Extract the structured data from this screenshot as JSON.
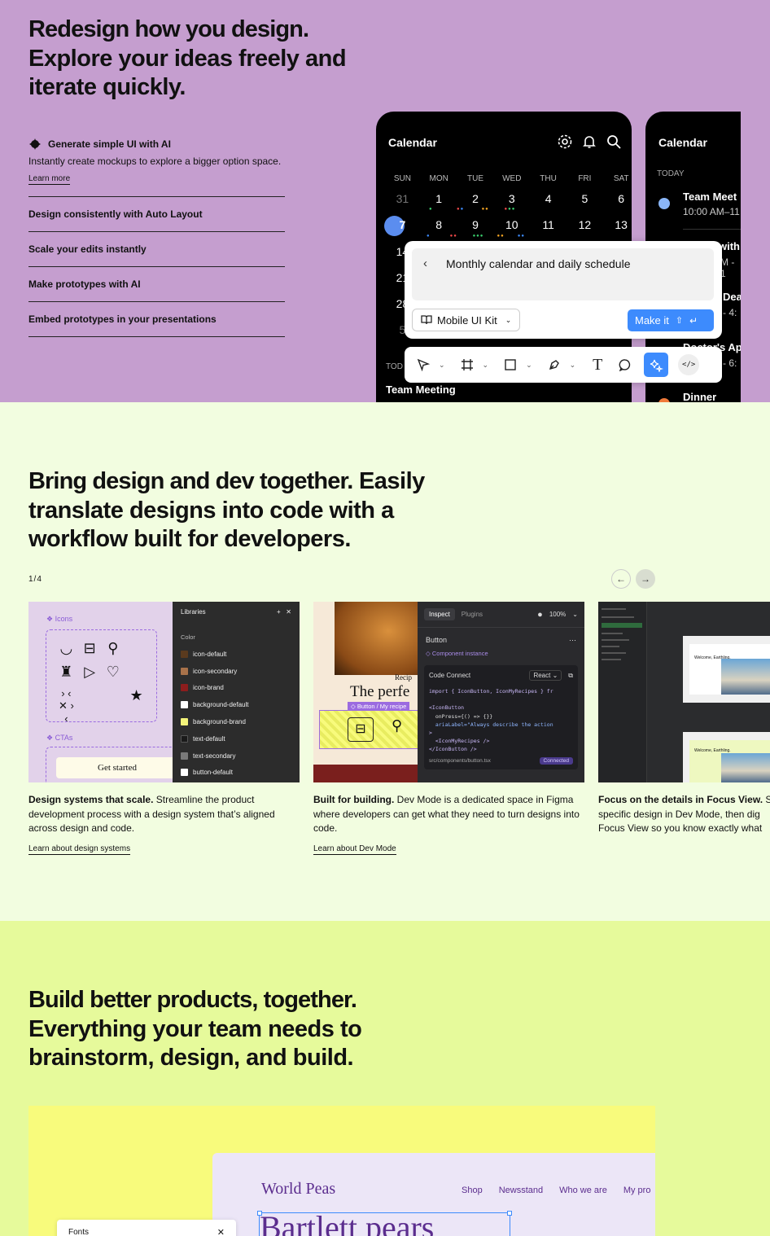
{
  "hero": {
    "title_bold": "Redesign how you design.",
    "title_rest": "Explore your ideas freely and iterate quickly.",
    "features": [
      {
        "title": "Generate simple UI with AI",
        "desc": "Instantly create mockups to explore a bigger option space.",
        "link": "Learn more",
        "active": true
      },
      {
        "title": "Design consistently with Auto Layout"
      },
      {
        "title": "Scale your edits instantly"
      },
      {
        "title": "Make prototypes with AI"
      },
      {
        "title": "Embed prototypes in your presentations"
      }
    ],
    "phone1": {
      "title": "Calendar",
      "weekdays": [
        "SUN",
        "MON",
        "TUE",
        "WED",
        "THU",
        "FRI",
        "SAT"
      ],
      "rows": [
        [
          "31",
          "1",
          "2",
          "3",
          "4",
          "5",
          "6"
        ],
        [
          "7",
          "8",
          "9",
          "10",
          "11",
          "12",
          "13"
        ],
        [
          "14"
        ],
        [
          "21"
        ],
        [
          "28"
        ],
        [
          "5"
        ]
      ],
      "today_label": "TOD",
      "event": "Team Meeting"
    },
    "phone2": {
      "title": "Calendar",
      "today_label": "TODAY",
      "events": [
        {
          "name": "Team Meet",
          "time": "10:00 AM–11"
        },
        {
          "name": "with",
          "time": "M - 1"
        },
        {
          "name": "Dea",
          "time": "- 4:"
        },
        {
          "name": "Doctor's Ap",
          "time": "- 6:"
        },
        {
          "name": "Dinner",
          "time": ""
        }
      ]
    },
    "prompt": {
      "text": "Monthly calendar and daily schedule",
      "kit": "Mobile UI Kit",
      "make": "Make it"
    }
  },
  "dev": {
    "title_bold": "Bring design and dev together.",
    "title_rest": "Easily translate designs into code with a workflow built for developers.",
    "pager": "1/4",
    "cards": [
      {
        "bold": "Design systems that scale.",
        "text": " Streamline the product development process with a design system that’s aligned across design and code.",
        "link": "Learn about design systems"
      },
      {
        "bold": "Built for building.",
        "text": " Dev Mode is a dedicated space in Figma where developers can get what they need to turn designs into code.",
        "link": "Learn about Dev Mode"
      },
      {
        "bold": "Focus on the details in Focus View.",
        "text": " Se specific design in Dev Mode, then dig Focus View so you know exactly what",
        "link": ""
      }
    ],
    "card1": {
      "icons_label": "Icons",
      "ctas_label": "CTAs",
      "cta_button": "Get started",
      "libraries_title": "Libraries",
      "color_label": "Color",
      "colors": [
        {
          "name": "icon-default",
          "color": "#5a3a1e"
        },
        {
          "name": "icon-secondary",
          "color": "#a8724a"
        },
        {
          "name": "icon-brand",
          "color": "#8c1d1d"
        },
        {
          "name": "background-default",
          "color": "#ffffff"
        },
        {
          "name": "background-brand",
          "color": "#f3f37a"
        },
        {
          "name": "text-default",
          "color": "#1a1a1a"
        },
        {
          "name": "text-secondary",
          "color": "#7a7a7a"
        },
        {
          "name": "button-default",
          "color": "#ffffff"
        }
      ]
    },
    "card2": {
      "recipe": "Recip",
      "headline": "The perfe",
      "selection": "Button / My recipe",
      "tabs": [
        "Inspect",
        "Plugins"
      ],
      "zoom": "100%",
      "layer": "Button",
      "instance": "Component instance",
      "code_connect": "Code Connect",
      "framework": "React",
      "code": [
        "import { IconButton, IconMyRecipes } fr",
        "",
        "<IconButton",
        "  onPress={() => {}}",
        "  ariaLabel=\"Always describe the action",
        ">",
        "  <IconMyRecipes />",
        "</IconButton />"
      ],
      "file": "src/components/button.tsx",
      "status": "Connected"
    }
  },
  "build": {
    "title_bold": "Build better products, together.",
    "title_rest": "Everything your team needs to brainstorm, design, and build.",
    "site": {
      "brand": "World Peas",
      "nav": [
        "Shop",
        "Newsstand",
        "Who we are",
        "My pro"
      ],
      "headline": "Bartlett pears",
      "fonts_panel": "Fonts"
    }
  },
  "colors": {
    "s1_bg": "#c59ecf",
    "s2_bg": "#f2fde0",
    "s3_bg": "#e6fa9b",
    "accent_blue": "#3d8bfd",
    "highlight_yellow": "#f8fb7c",
    "site_purple": "#5b2d8e"
  }
}
